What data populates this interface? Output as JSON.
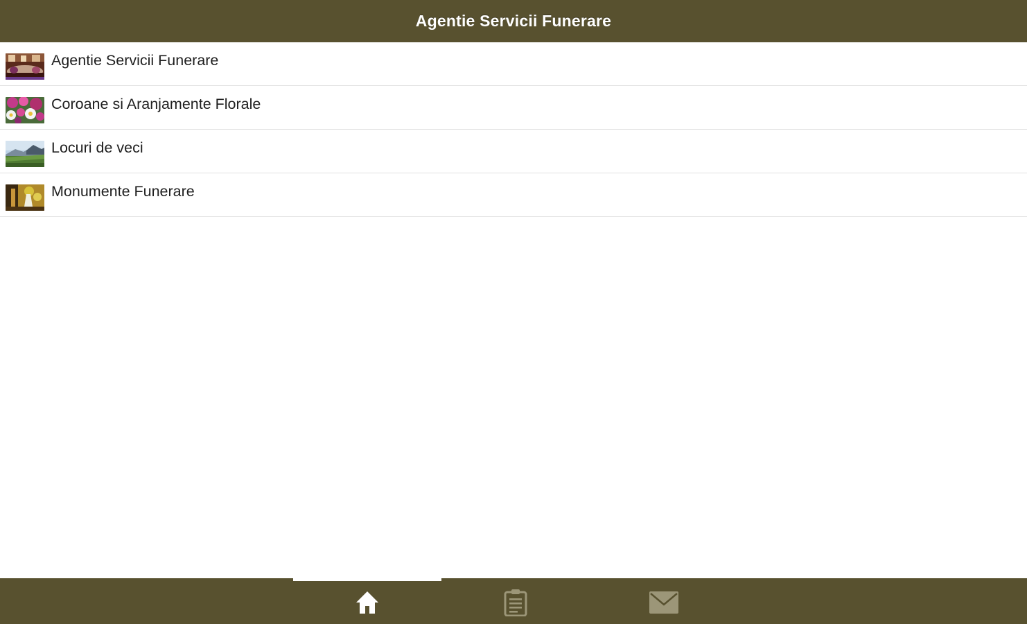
{
  "header": {
    "title": "Agentie Servicii Funerare"
  },
  "menu": {
    "items": [
      {
        "label": "Agentie Servicii Funerare",
        "icon": "funeral-service-thumbnail"
      },
      {
        "label": "Coroane si Aranjamente Florale",
        "icon": "flower-arrangement-thumbnail"
      },
      {
        "label": "Locuri de veci",
        "icon": "cemetery-landscape-thumbnail"
      },
      {
        "label": "Monumente Funerare",
        "icon": "monument-thumbnail"
      }
    ]
  },
  "tabbar": {
    "tabs": [
      {
        "icon": "home-icon",
        "active": true
      },
      {
        "icon": "clipboard-icon",
        "active": false
      },
      {
        "icon": "mail-icon",
        "active": false
      }
    ]
  },
  "colors": {
    "bar": "#58512f",
    "active_icon": "#ffffff",
    "inactive_icon": "#9c9678",
    "divider": "#e1e1e1"
  }
}
